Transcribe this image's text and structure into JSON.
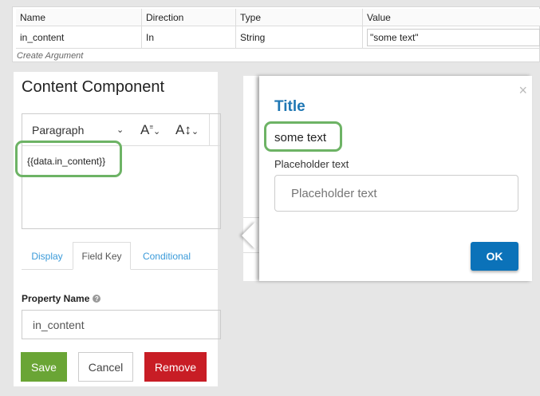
{
  "arguments": {
    "headers": [
      "Name",
      "Direction",
      "Type",
      "Value"
    ],
    "rows": [
      {
        "name": "in_content",
        "direction": "In",
        "type": "String",
        "value": "\"some text\""
      }
    ],
    "create_label": "Create Argument"
  },
  "component": {
    "title": "Content Component",
    "toolbar": {
      "format": "Paragraph"
    },
    "content": "{{data.in_content}}",
    "tabs": [
      "Display",
      "Field Key",
      "Conditional"
    ],
    "property_label": "Property Name",
    "property_value": "in_content",
    "buttons": {
      "save": "Save",
      "cancel": "Cancel",
      "remove": "Remove"
    }
  },
  "preview": {
    "title": "Title",
    "text": "some text",
    "field_label": "Placeholder text",
    "field_placeholder": "Placeholder text",
    "ok": "OK",
    "close": "×"
  },
  "colors": {
    "highlight": "#6db365",
    "save": "#6aa535",
    "remove": "#c81d25",
    "ok": "#0b72b9",
    "title": "#1f77b4"
  }
}
